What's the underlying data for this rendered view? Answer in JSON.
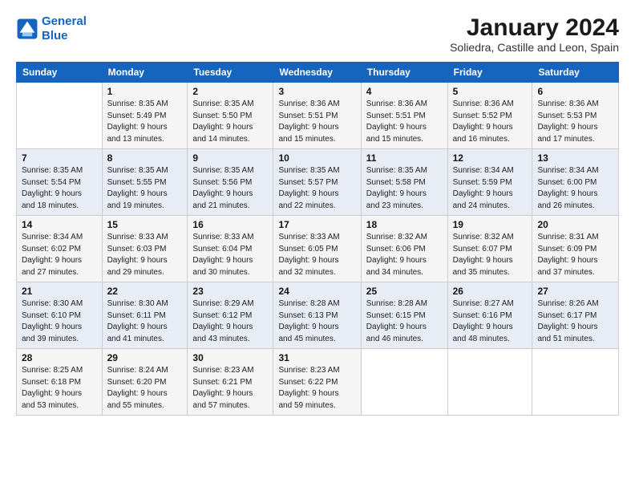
{
  "logo": {
    "text_general": "General",
    "text_blue": "Blue"
  },
  "title": "January 2024",
  "subtitle": "Soliedra, Castille and Leon, Spain",
  "headers": [
    "Sunday",
    "Monday",
    "Tuesday",
    "Wednesday",
    "Thursday",
    "Friday",
    "Saturday"
  ],
  "weeks": [
    [
      {
        "num": "",
        "sunrise": "",
        "sunset": "",
        "daylight": ""
      },
      {
        "num": "1",
        "sunrise": "Sunrise: 8:35 AM",
        "sunset": "Sunset: 5:49 PM",
        "daylight": "Daylight: 9 hours and 13 minutes."
      },
      {
        "num": "2",
        "sunrise": "Sunrise: 8:35 AM",
        "sunset": "Sunset: 5:50 PM",
        "daylight": "Daylight: 9 hours and 14 minutes."
      },
      {
        "num": "3",
        "sunrise": "Sunrise: 8:36 AM",
        "sunset": "Sunset: 5:51 PM",
        "daylight": "Daylight: 9 hours and 15 minutes."
      },
      {
        "num": "4",
        "sunrise": "Sunrise: 8:36 AM",
        "sunset": "Sunset: 5:51 PM",
        "daylight": "Daylight: 9 hours and 15 minutes."
      },
      {
        "num": "5",
        "sunrise": "Sunrise: 8:36 AM",
        "sunset": "Sunset: 5:52 PM",
        "daylight": "Daylight: 9 hours and 16 minutes."
      },
      {
        "num": "6",
        "sunrise": "Sunrise: 8:36 AM",
        "sunset": "Sunset: 5:53 PM",
        "daylight": "Daylight: 9 hours and 17 minutes."
      }
    ],
    [
      {
        "num": "7",
        "sunrise": "Sunrise: 8:35 AM",
        "sunset": "Sunset: 5:54 PM",
        "daylight": "Daylight: 9 hours and 18 minutes."
      },
      {
        "num": "8",
        "sunrise": "Sunrise: 8:35 AM",
        "sunset": "Sunset: 5:55 PM",
        "daylight": "Daylight: 9 hours and 19 minutes."
      },
      {
        "num": "9",
        "sunrise": "Sunrise: 8:35 AM",
        "sunset": "Sunset: 5:56 PM",
        "daylight": "Daylight: 9 hours and 21 minutes."
      },
      {
        "num": "10",
        "sunrise": "Sunrise: 8:35 AM",
        "sunset": "Sunset: 5:57 PM",
        "daylight": "Daylight: 9 hours and 22 minutes."
      },
      {
        "num": "11",
        "sunrise": "Sunrise: 8:35 AM",
        "sunset": "Sunset: 5:58 PM",
        "daylight": "Daylight: 9 hours and 23 minutes."
      },
      {
        "num": "12",
        "sunrise": "Sunrise: 8:34 AM",
        "sunset": "Sunset: 5:59 PM",
        "daylight": "Daylight: 9 hours and 24 minutes."
      },
      {
        "num": "13",
        "sunrise": "Sunrise: 8:34 AM",
        "sunset": "Sunset: 6:00 PM",
        "daylight": "Daylight: 9 hours and 26 minutes."
      }
    ],
    [
      {
        "num": "14",
        "sunrise": "Sunrise: 8:34 AM",
        "sunset": "Sunset: 6:02 PM",
        "daylight": "Daylight: 9 hours and 27 minutes."
      },
      {
        "num": "15",
        "sunrise": "Sunrise: 8:33 AM",
        "sunset": "Sunset: 6:03 PM",
        "daylight": "Daylight: 9 hours and 29 minutes."
      },
      {
        "num": "16",
        "sunrise": "Sunrise: 8:33 AM",
        "sunset": "Sunset: 6:04 PM",
        "daylight": "Daylight: 9 hours and 30 minutes."
      },
      {
        "num": "17",
        "sunrise": "Sunrise: 8:33 AM",
        "sunset": "Sunset: 6:05 PM",
        "daylight": "Daylight: 9 hours and 32 minutes."
      },
      {
        "num": "18",
        "sunrise": "Sunrise: 8:32 AM",
        "sunset": "Sunset: 6:06 PM",
        "daylight": "Daylight: 9 hours and 34 minutes."
      },
      {
        "num": "19",
        "sunrise": "Sunrise: 8:32 AM",
        "sunset": "Sunset: 6:07 PM",
        "daylight": "Daylight: 9 hours and 35 minutes."
      },
      {
        "num": "20",
        "sunrise": "Sunrise: 8:31 AM",
        "sunset": "Sunset: 6:09 PM",
        "daylight": "Daylight: 9 hours and 37 minutes."
      }
    ],
    [
      {
        "num": "21",
        "sunrise": "Sunrise: 8:30 AM",
        "sunset": "Sunset: 6:10 PM",
        "daylight": "Daylight: 9 hours and 39 minutes."
      },
      {
        "num": "22",
        "sunrise": "Sunrise: 8:30 AM",
        "sunset": "Sunset: 6:11 PM",
        "daylight": "Daylight: 9 hours and 41 minutes."
      },
      {
        "num": "23",
        "sunrise": "Sunrise: 8:29 AM",
        "sunset": "Sunset: 6:12 PM",
        "daylight": "Daylight: 9 hours and 43 minutes."
      },
      {
        "num": "24",
        "sunrise": "Sunrise: 8:28 AM",
        "sunset": "Sunset: 6:13 PM",
        "daylight": "Daylight: 9 hours and 45 minutes."
      },
      {
        "num": "25",
        "sunrise": "Sunrise: 8:28 AM",
        "sunset": "Sunset: 6:15 PM",
        "daylight": "Daylight: 9 hours and 46 minutes."
      },
      {
        "num": "26",
        "sunrise": "Sunrise: 8:27 AM",
        "sunset": "Sunset: 6:16 PM",
        "daylight": "Daylight: 9 hours and 48 minutes."
      },
      {
        "num": "27",
        "sunrise": "Sunrise: 8:26 AM",
        "sunset": "Sunset: 6:17 PM",
        "daylight": "Daylight: 9 hours and 51 minutes."
      }
    ],
    [
      {
        "num": "28",
        "sunrise": "Sunrise: 8:25 AM",
        "sunset": "Sunset: 6:18 PM",
        "daylight": "Daylight: 9 hours and 53 minutes."
      },
      {
        "num": "29",
        "sunrise": "Sunrise: 8:24 AM",
        "sunset": "Sunset: 6:20 PM",
        "daylight": "Daylight: 9 hours and 55 minutes."
      },
      {
        "num": "30",
        "sunrise": "Sunrise: 8:23 AM",
        "sunset": "Sunset: 6:21 PM",
        "daylight": "Daylight: 9 hours and 57 minutes."
      },
      {
        "num": "31",
        "sunrise": "Sunrise: 8:23 AM",
        "sunset": "Sunset: 6:22 PM",
        "daylight": "Daylight: 9 hours and 59 minutes."
      },
      {
        "num": "",
        "sunrise": "",
        "sunset": "",
        "daylight": ""
      },
      {
        "num": "",
        "sunrise": "",
        "sunset": "",
        "daylight": ""
      },
      {
        "num": "",
        "sunrise": "",
        "sunset": "",
        "daylight": ""
      }
    ]
  ]
}
